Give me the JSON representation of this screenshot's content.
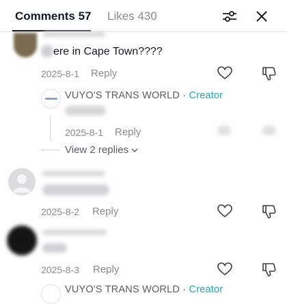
{
  "header": {
    "comments_tab": "Comments 57",
    "likes_tab": "Likes 430",
    "filter_icon": "sliders-icon",
    "close_icon": "close-icon"
  },
  "comments": [
    {
      "text_visible": "ere in Cape Town????",
      "date": "2025-8-1",
      "reply_label": "Reply",
      "creator_reply": {
        "author": "VUYO'S TRANS WORLD",
        "separator": "·",
        "badge": "Creator",
        "date": "2025-8-1",
        "reply_label": "Reply"
      },
      "view_replies": "View 2 replies"
    },
    {
      "date": "2025-8-2",
      "reply_label": "Reply"
    },
    {
      "date": "2025-8-3",
      "reply_label": "Reply",
      "creator_reply_partial": {
        "author": "VUYO'S TRANS WORLD",
        "separator": "·",
        "badge": "Creator"
      }
    }
  ],
  "icons": {
    "like": "heart-icon",
    "dislike": "thumbs-down-icon",
    "default_avatar": "user-icon",
    "chevron": "chevron-down-icon"
  },
  "colors": {
    "creator_badge": "#20a4c0",
    "muted_text": "#8a8b91",
    "primary_text": "#161823"
  }
}
